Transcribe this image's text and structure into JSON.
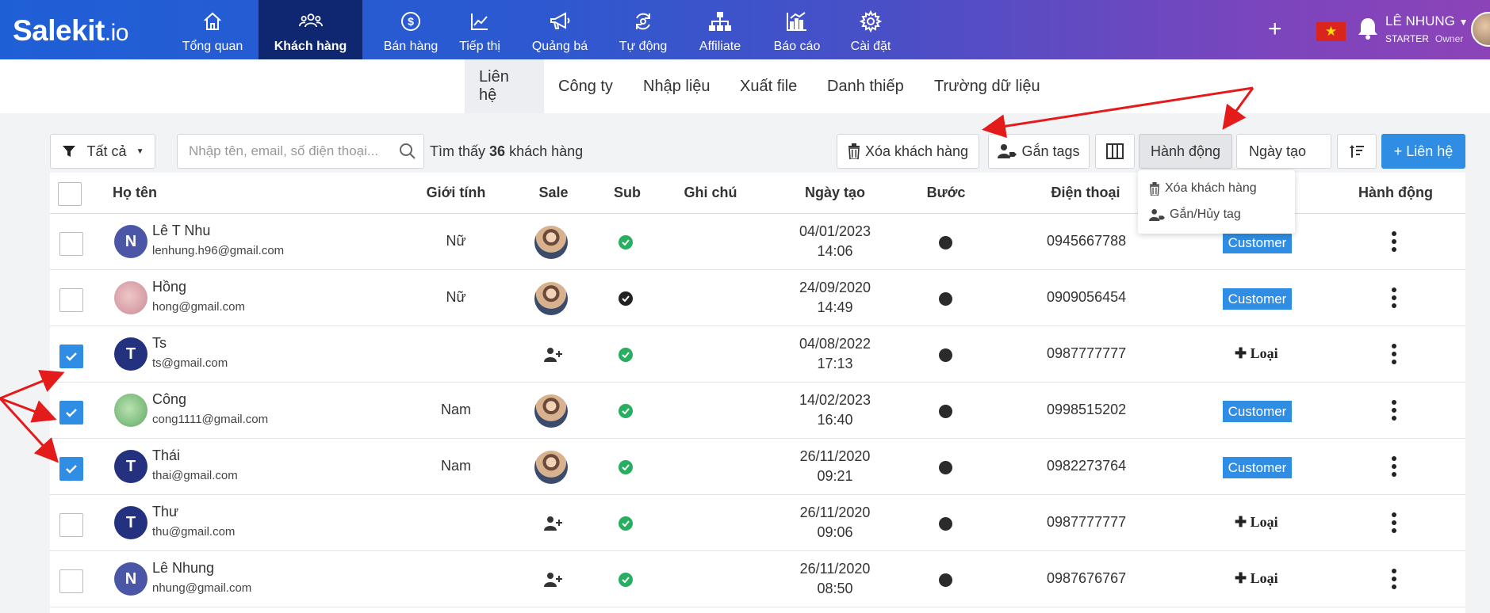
{
  "brand": {
    "logo_main": "Salekit",
    "logo_suffix": ".io"
  },
  "nav": {
    "items": [
      {
        "label": "Tổng quan",
        "icon": "home-icon"
      },
      {
        "label": "Khách hàng",
        "icon": "users-icon",
        "active": true
      },
      {
        "label": "Bán hàng",
        "icon": "dollar-icon"
      },
      {
        "label": "Tiếp thị",
        "icon": "chart-line-icon"
      },
      {
        "label": "Quảng bá",
        "icon": "megaphone-icon"
      },
      {
        "label": "Tự động",
        "icon": "automation-icon"
      },
      {
        "label": "Affiliate",
        "icon": "sitemap-icon"
      },
      {
        "label": "Báo cáo",
        "icon": "report-icon"
      },
      {
        "label": "Cài đặt",
        "icon": "gear-icon"
      }
    ],
    "plus": "+",
    "flag_star": "★",
    "user_name": "LÊ NHUNG",
    "user_plan": "STARTER",
    "user_role": "Owner"
  },
  "subnav": {
    "tabs": [
      "Liên hệ",
      "Công ty",
      "Nhập liệu",
      "Xuất file",
      "Danh thiếp",
      "Trường dữ liệu"
    ]
  },
  "toolbar": {
    "filter_label": "Tất cả",
    "search_placeholder": "Nhập tên, email, số điện thoại...",
    "found_prefix": "Tìm thấy",
    "found_count": "36",
    "found_suffix": "khách hàng",
    "delete_label": "Xóa khách hàng",
    "tags_label": "Gắn tags",
    "action_label": "Hành động",
    "date_label": "Ngày tạo",
    "add_label": "+ Liên hệ"
  },
  "action_menu": {
    "items": [
      "Xóa khách hàng",
      "Gắn/Hủy tag"
    ]
  },
  "table": {
    "headers": {
      "name": "Họ tên",
      "gender": "Giới tính",
      "sale": "Sale",
      "sub": "Sub",
      "note": "Ghi chú",
      "created": "Ngày tạo",
      "step": "Bước",
      "phone": "Điện thoại",
      "action": "Hành động"
    },
    "rows": [
      {
        "initial": "N",
        "name": "Lê T Nhu",
        "email": "lenhung.h96@gmail.com",
        "gender": "Nữ",
        "date": "04/01/2023",
        "time": "14:06",
        "phone": "0945667788",
        "type": "Customer",
        "checked": false,
        "sale": "avatar",
        "sub": "green",
        "avatar_color": "#4b57a6"
      },
      {
        "initial": "",
        "name": "Hồng",
        "email": "hong@gmail.com",
        "gender": "Nữ",
        "date": "24/09/2020",
        "time": "14:49",
        "phone": "0909056454",
        "type": "Customer",
        "checked": false,
        "sale": "avatar",
        "sub": "dark",
        "avatar_color": "img1"
      },
      {
        "initial": "T",
        "name": "Ts",
        "email": "ts@gmail.com",
        "gender": "",
        "date": "04/08/2022",
        "time": "17:13",
        "phone": "0987777777",
        "type": "Loại",
        "checked": true,
        "sale": "add",
        "sub": "green",
        "avatar_color": "#23317f"
      },
      {
        "initial": "",
        "name": "Công",
        "email": "cong1111@gmail.com",
        "gender": "Nam",
        "date": "14/02/2023",
        "time": "16:40",
        "phone": "0998515202",
        "type": "Customer",
        "checked": true,
        "sale": "avatar",
        "sub": "green",
        "avatar_color": "img2"
      },
      {
        "initial": "T",
        "name": "Thái",
        "email": "thai@gmail.com",
        "gender": "Nam",
        "date": "26/11/2020",
        "time": "09:21",
        "phone": "0982273764",
        "type": "Customer",
        "checked": true,
        "sale": "avatar",
        "sub": "green",
        "avatar_color": "#23317f"
      },
      {
        "initial": "T",
        "name": "Thư",
        "email": "thu@gmail.com",
        "gender": "",
        "date": "26/11/2020",
        "time": "09:06",
        "phone": "0987777777",
        "type": "Loại",
        "checked": false,
        "sale": "add",
        "sub": "green",
        "avatar_color": "#23317f"
      },
      {
        "initial": "N",
        "name": "Lê Nhung",
        "email": "nhung@gmail.com",
        "gender": "",
        "date": "26/11/2020",
        "time": "08:50",
        "phone": "0987676767",
        "type": "Loại",
        "checked": false,
        "sale": "add",
        "sub": "green",
        "avatar_color": "#4b57a6"
      }
    ]
  },
  "colors": {
    "primary": "#2f8de4",
    "nav_active": "#0e2770",
    "sub_green": "#27ae60",
    "annotation_red": "#e41b1b"
  }
}
